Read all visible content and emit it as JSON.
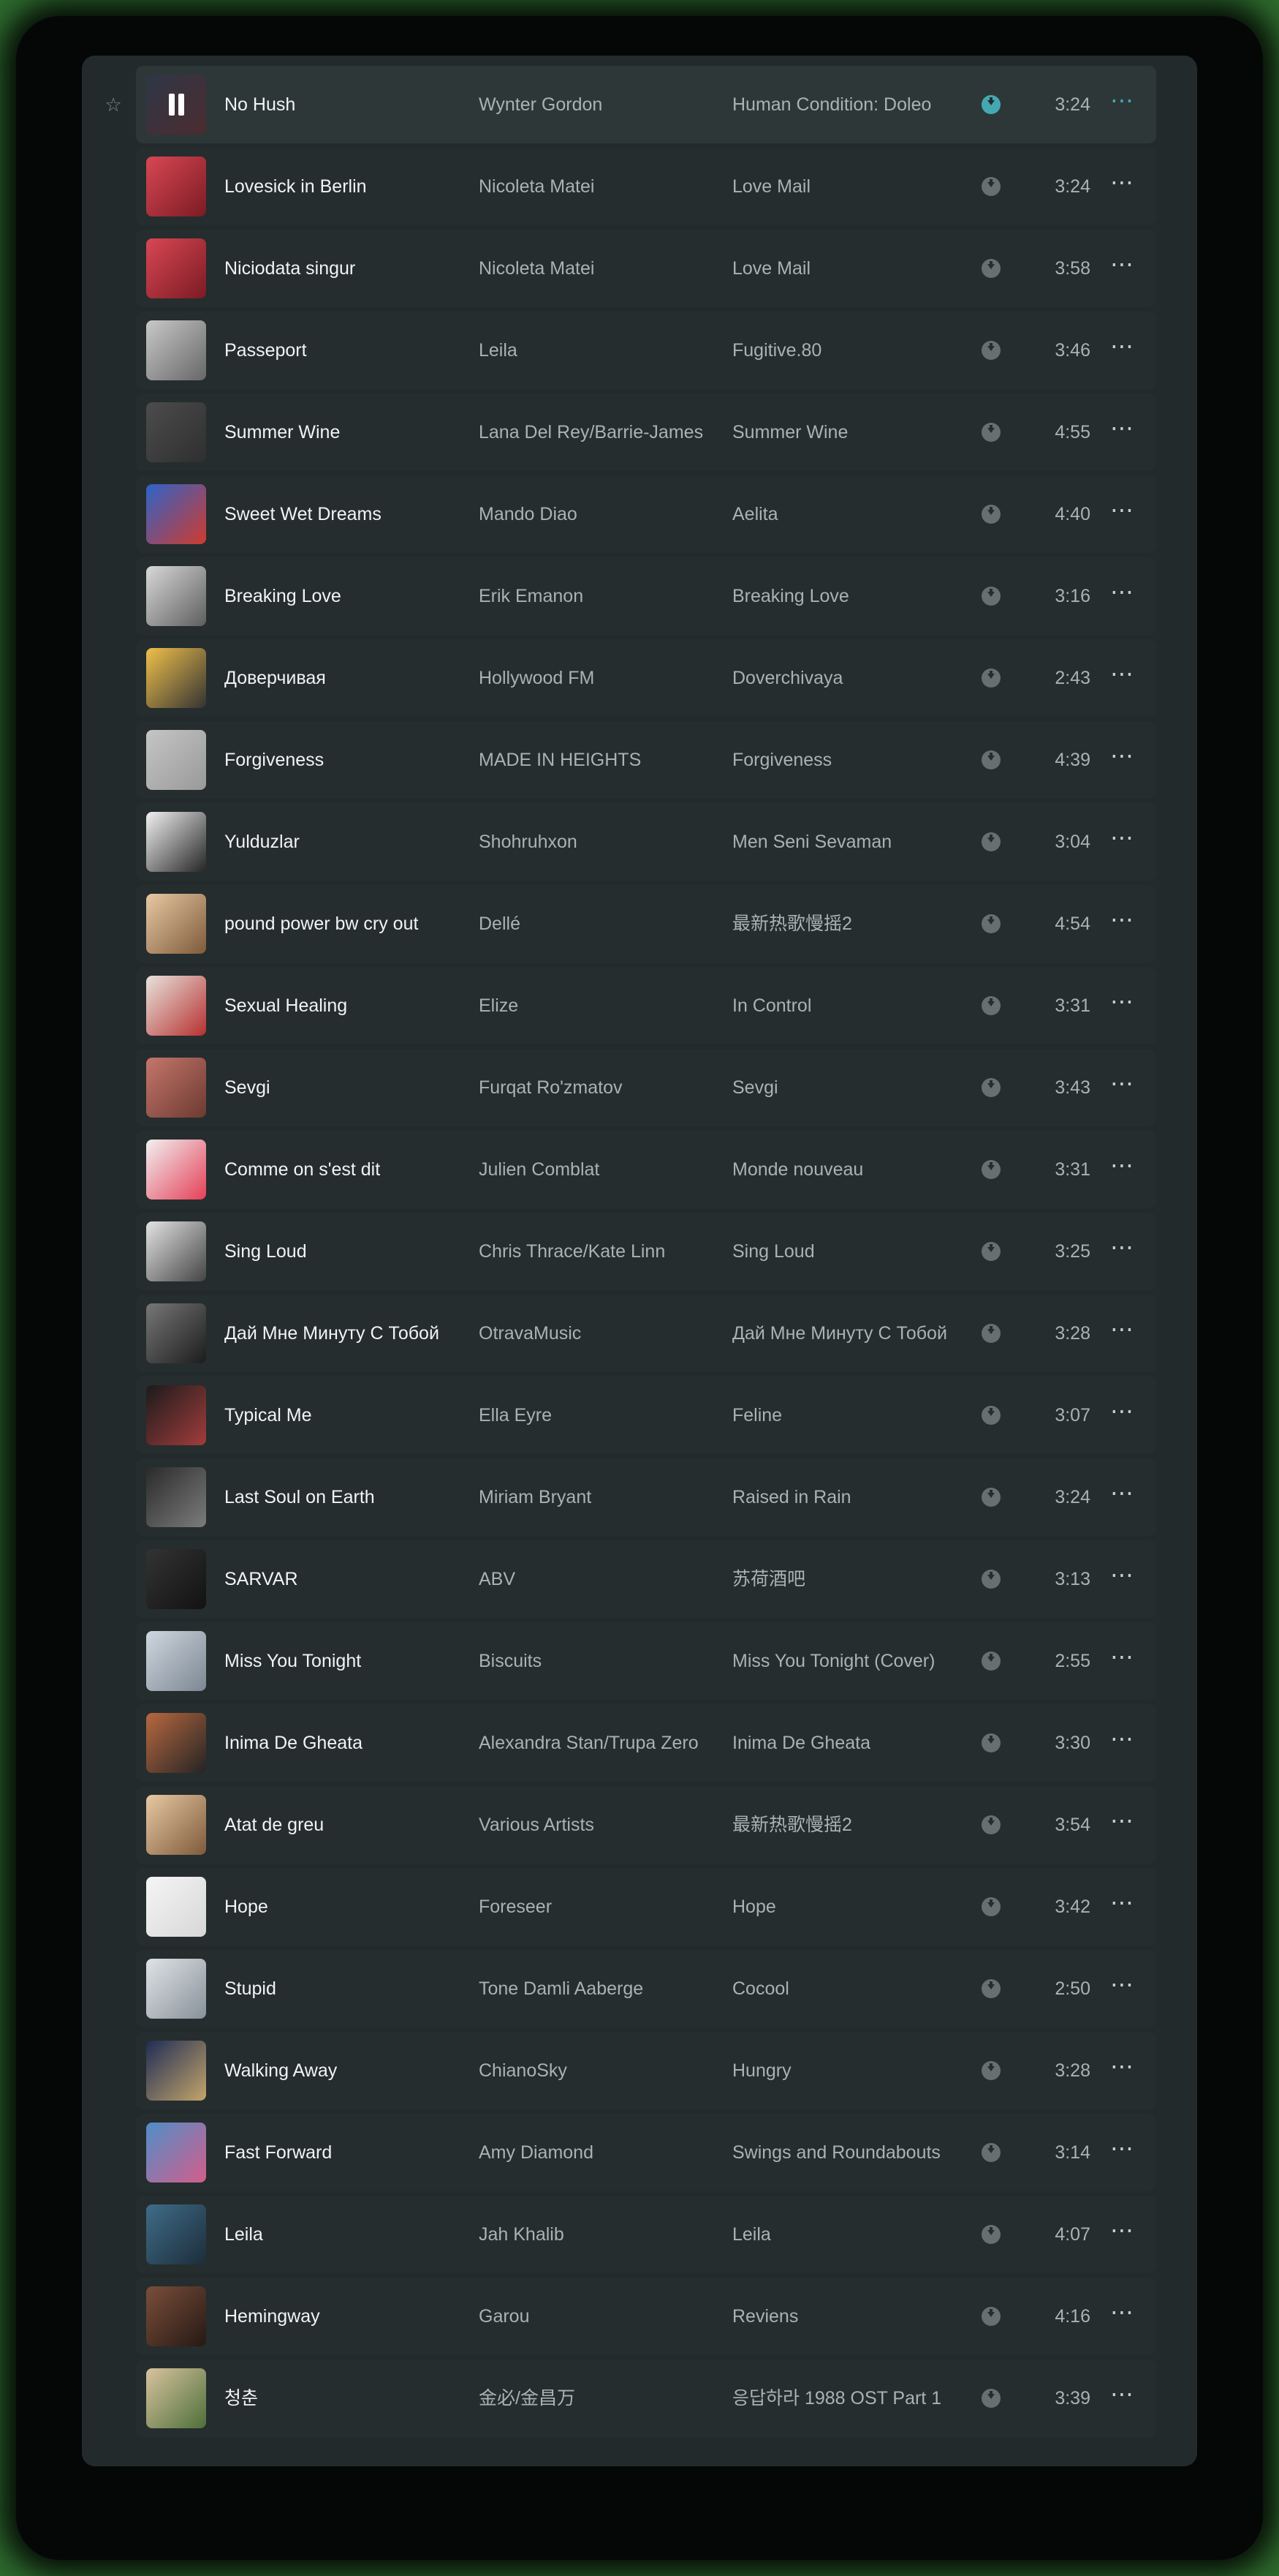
{
  "tracks": [
    {
      "title": "No Hush",
      "artist": "Wynter Gordon",
      "album": "Human Condition: Doleo",
      "duration": "3:24",
      "active": true,
      "cover_colors": [
        "#434e66",
        "#6d4044"
      ]
    },
    {
      "title": "Lovesick in Berlin",
      "artist": "Nicoleta Matei",
      "album": "Love Mail",
      "duration": "3:24",
      "cover_colors": [
        "#d84754",
        "#7b1b23"
      ]
    },
    {
      "title": "Niciodata singur",
      "artist": "Nicoleta Matei",
      "album": "Love Mail",
      "duration": "3:58",
      "cover_colors": [
        "#d84754",
        "#7b1b23"
      ]
    },
    {
      "title": "Passeport",
      "artist": "Leila",
      "album": "Fugitive.80",
      "duration": "3:46",
      "cover_colors": [
        "#c8c8c8",
        "#676767"
      ]
    },
    {
      "title": "Summer Wine",
      "artist": "Lana Del Rey/Barrie-James",
      "album": "Summer Wine",
      "duration": "4:55",
      "cover_colors": [
        "#4c4c4c",
        "#2f2f2f"
      ]
    },
    {
      "title": "Sweet Wet Dreams",
      "artist": "Mando Diao",
      "album": "Aelita",
      "duration": "4:40",
      "cover_colors": [
        "#2d63c9",
        "#d03b2d"
      ]
    },
    {
      "title": "Breaking Love",
      "artist": "Erik Emanon",
      "album": "Breaking Love",
      "duration": "3:16",
      "cover_colors": [
        "#d8d8d8",
        "#5e5e5e"
      ]
    },
    {
      "title": "Доверчивая",
      "artist": "Hollywood FM",
      "album": "Doverchivaya",
      "duration": "2:43",
      "cover_colors": [
        "#f0c04a",
        "#333333"
      ]
    },
    {
      "title": "Forgiveness",
      "artist": "MADE IN HEIGHTS",
      "album": "Forgiveness",
      "duration": "4:39",
      "cover_colors": [
        "#c5c5c5",
        "#999999"
      ]
    },
    {
      "title": "Yulduzlar",
      "artist": "Shohruhxon",
      "album": "Men Seni Sevaman",
      "duration": "3:04",
      "cover_colors": [
        "#f1f1f1",
        "#252525"
      ]
    },
    {
      "title": "pound power bw cry out",
      "artist": "Dellé",
      "album": "最新热歌慢摇2",
      "duration": "4:54",
      "cover_colors": [
        "#e7c9a3",
        "#7e5a3a"
      ]
    },
    {
      "title": "Sexual Healing",
      "artist": "Elize",
      "album": "In Control",
      "duration": "3:31",
      "cover_colors": [
        "#e8e3dc",
        "#b63030"
      ]
    },
    {
      "title": "Sevgi",
      "artist": "Furqat Ro'zmatov",
      "album": "Sevgi",
      "duration": "3:43",
      "cover_colors": [
        "#c5766a",
        "#6c3a31"
      ]
    },
    {
      "title": "Comme on s'est dit",
      "artist": "Julien Comblat",
      "album": "Monde nouveau",
      "duration": "3:31",
      "cover_colors": [
        "#f1f1f1",
        "#e53f57"
      ]
    },
    {
      "title": "Sing Loud",
      "artist": "Chris Thrace/Kate Linn",
      "album": "Sing Loud",
      "duration": "3:25",
      "cover_colors": [
        "#e3e3e3",
        "#444444"
      ]
    },
    {
      "title": "Дай Мне Минуту С Тобой",
      "artist": "OtravaMusic",
      "album": "Дай Мне Минуту С Тобой",
      "duration": "3:28",
      "cover_colors": [
        "#777777",
        "#1c1c1c"
      ]
    },
    {
      "title": "Typical Me",
      "artist": "Ella Eyre",
      "album": "Feline",
      "duration": "3:07",
      "cover_colors": [
        "#1b1b1b",
        "#a33c3c"
      ]
    },
    {
      "title": "Last Soul on Earth",
      "artist": "Miriam Bryant",
      "album": "Raised in Rain",
      "duration": "3:24",
      "cover_colors": [
        "#2a2a2a",
        "#7c7c7c"
      ]
    },
    {
      "title": "SARVAR",
      "artist": "ABV",
      "album": "苏荷酒吧",
      "duration": "3:13",
      "cover_colors": [
        "#333333",
        "#121212"
      ]
    },
    {
      "title": "Miss You Tonight",
      "artist": "Biscuits",
      "album": "Miss You Tonight (Cover)",
      "duration": "2:55",
      "cover_colors": [
        "#cfd7df",
        "#7c8793"
      ]
    },
    {
      "title": "Inima De Gheata",
      "artist": "Alexandra Stan/Trupa Zero",
      "album": "Inima De Gheata",
      "duration": "3:30",
      "cover_colors": [
        "#b8683f",
        "#242424"
      ]
    },
    {
      "title": "Atat de greu",
      "artist": "Various Artists",
      "album": "最新热歌慢摇2",
      "duration": "3:54",
      "cover_colors": [
        "#e7c9a3",
        "#7e5a3a"
      ]
    },
    {
      "title": "Hope",
      "artist": "Foreseer",
      "album": "Hope",
      "duration": "3:42",
      "cover_colors": [
        "#f5f5f5",
        "#d7d7d7"
      ]
    },
    {
      "title": "Stupid",
      "artist": "Tone Damli Aaberge",
      "album": "Cocool",
      "duration": "2:50",
      "cover_colors": [
        "#dfe3e6",
        "#88919a"
      ]
    },
    {
      "title": "Walking Away",
      "artist": "ChianoSky",
      "album": "Hungry",
      "duration": "3:28",
      "cover_colors": [
        "#1e2d55",
        "#c4a46a"
      ]
    },
    {
      "title": "Fast Forward",
      "artist": "Amy Diamond",
      "album": "Swings and Roundabouts",
      "duration": "3:14",
      "cover_colors": [
        "#4f8ec9",
        "#d35e8a"
      ]
    },
    {
      "title": "Leila",
      "artist": "Jah Khalib",
      "album": "Leila",
      "duration": "4:07",
      "cover_colors": [
        "#3f6c88",
        "#1d2d3a"
      ]
    },
    {
      "title": "Hemingway",
      "artist": "Garou",
      "album": "Reviens",
      "duration": "4:16",
      "cover_colors": [
        "#7a4e3a",
        "#251914"
      ]
    },
    {
      "title": "청춘",
      "artist": "金必/金昌万",
      "album": "응답하라 1988 OST Part 1",
      "duration": "3:39",
      "cover_colors": [
        "#d8c39e",
        "#4e6f3a"
      ]
    }
  ]
}
